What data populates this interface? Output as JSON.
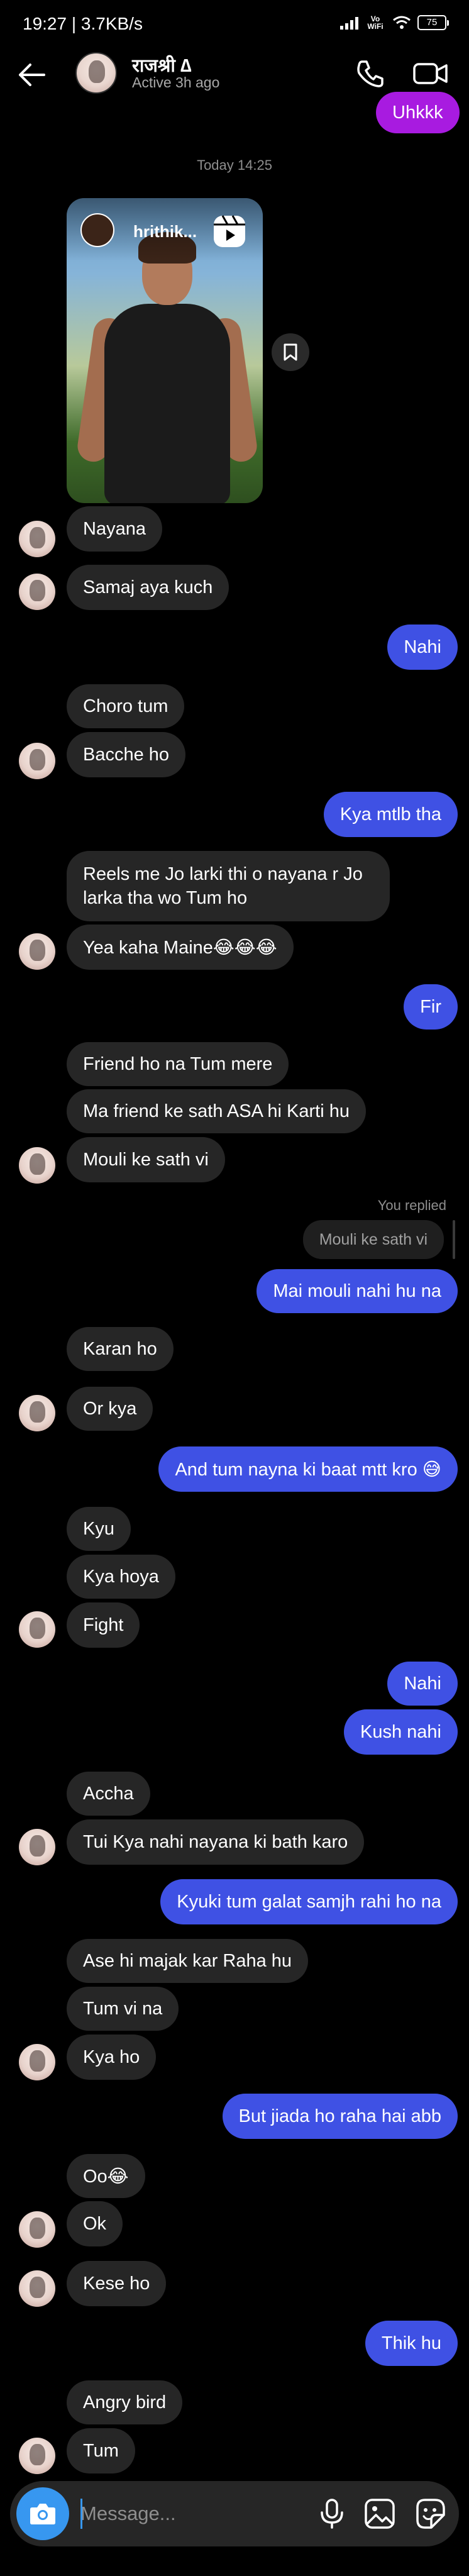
{
  "status_bar": {
    "time_data": "19:27 | 3.7KB/s",
    "network": "Vo WiFi",
    "battery": "75"
  },
  "header": {
    "name": "राजश्री ∆",
    "status": "Active 3h ago"
  },
  "conversation": {
    "top_partial_sent": "Uhkkk",
    "timestamp": "Today 14:25",
    "reel_username": "hrithik...",
    "messages": [
      {
        "side": "recv",
        "text": "Nayana"
      },
      {
        "side": "recv",
        "text": "Samaj aya kuch"
      },
      {
        "side": "sent",
        "text": "Nahi"
      },
      {
        "side": "recv",
        "text": "Choro tum"
      },
      {
        "side": "recv",
        "text": "Bacche ho"
      },
      {
        "side": "sent",
        "text": "Kya mtlb tha"
      },
      {
        "side": "recv",
        "text": "Reels me Jo larki thi o nayana r Jo larka tha wo Tum ho"
      },
      {
        "side": "recv",
        "text": "Yea kaha Maine😂😂😂"
      },
      {
        "side": "sent",
        "text": "Fir"
      },
      {
        "side": "recv",
        "text": "Friend ho na Tum mere"
      },
      {
        "side": "recv",
        "text": "Ma friend ke sath ASA hi Karti hu"
      },
      {
        "side": "recv",
        "text": "Mouli ke sath vi"
      },
      {
        "side": "sent",
        "text": "Mai mouli nahi hu na"
      },
      {
        "side": "recv",
        "text": "Karan ho"
      },
      {
        "side": "recv",
        "text": "Or kya"
      },
      {
        "side": "sent",
        "text": "And tum nayna ki baat mtt kro 😅"
      },
      {
        "side": "recv",
        "text": "Kyu"
      },
      {
        "side": "recv",
        "text": "Kya hoya"
      },
      {
        "side": "recv",
        "text": "Fight"
      },
      {
        "side": "sent",
        "text": "Nahi"
      },
      {
        "side": "sent",
        "text": "Kush nahi"
      },
      {
        "side": "recv",
        "text": "Accha"
      },
      {
        "side": "recv",
        "text": "Tui Kya nahi nayana ki bath karo"
      },
      {
        "side": "sent",
        "text": "Kyuki tum galat samjh rahi ho na"
      },
      {
        "side": "recv",
        "text": "Ase hi majak kar Raha hu"
      },
      {
        "side": "recv",
        "text": "Tum vi na"
      },
      {
        "side": "recv",
        "text": "Kya ho"
      },
      {
        "side": "sent",
        "text": "But jiada ho raha hai abb"
      },
      {
        "side": "recv",
        "text": "Oo😂"
      },
      {
        "side": "recv",
        "text": "Ok"
      },
      {
        "side": "recv",
        "text": "Kese ho"
      },
      {
        "side": "sent",
        "text": "Thik hu"
      },
      {
        "side": "recv",
        "text": "Angry bird"
      },
      {
        "side": "recv",
        "text": "Tum"
      }
    ],
    "reply": {
      "label": "You replied",
      "quoted": "Mouli ke sath vi"
    }
  },
  "composer": {
    "placeholder": "Message..."
  },
  "icons": {
    "back": "arrow-left-icon",
    "call": "phone-icon",
    "video": "video-camera-icon",
    "camera": "camera-icon",
    "mic": "microphone-icon",
    "gallery": "gallery-icon",
    "sticker": "sticker-icon",
    "save": "bookmark-icon",
    "reel": "reel-icon"
  },
  "colors": {
    "background": "#000000",
    "received_bubble": "#262626",
    "sent_bubble": "#3f51e4",
    "sent_bubble_top": "#a81be0",
    "accent": "#3797f0"
  }
}
